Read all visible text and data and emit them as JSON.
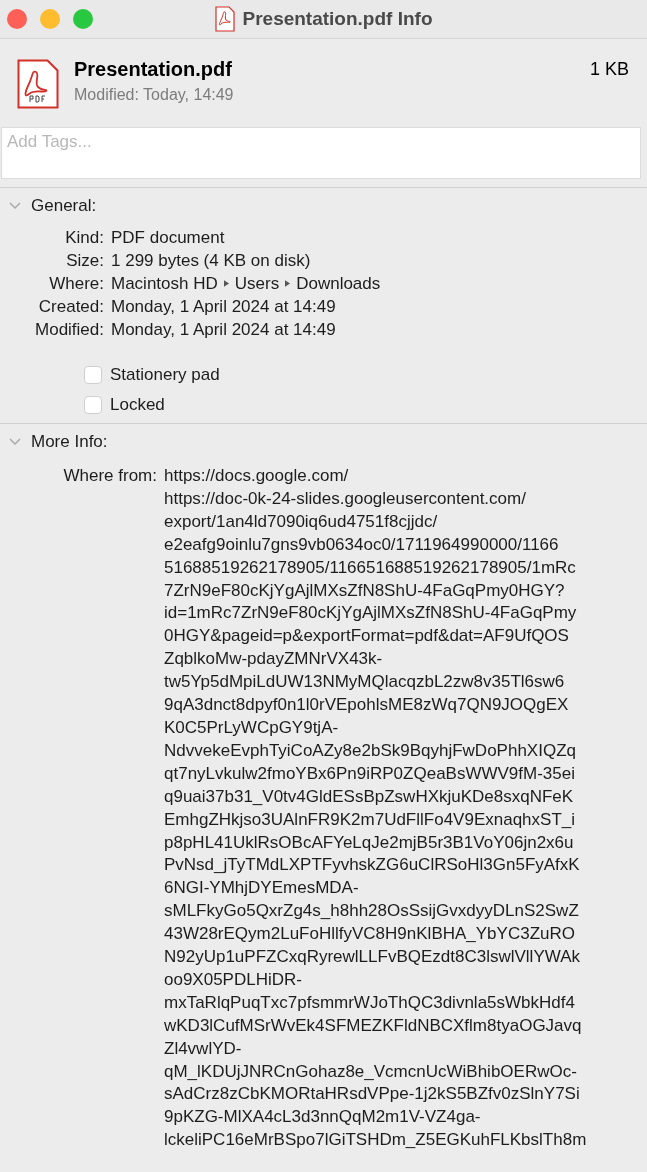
{
  "window": {
    "title": "Presentation.pdf Info"
  },
  "file": {
    "name": "Presentation.pdf",
    "size": "1 KB",
    "modified": "Modified: Today, 14:49"
  },
  "tags": {
    "placeholder": "Add Tags..."
  },
  "general": {
    "title": "General:",
    "expanded": true,
    "rows": [
      {
        "label": "Kind:",
        "value": "PDF document"
      },
      {
        "label": "Size:",
        "value": "1 299 bytes (4 KB on disk)"
      },
      {
        "label": "Where:",
        "path": [
          "Macintosh HD",
          "Users",
          "Downloads"
        ]
      },
      {
        "label": "Created:",
        "value": "Monday, 1 April 2024 at 14:49"
      },
      {
        "label": "Modified:",
        "value": "Monday, 1 April 2024 at 14:49"
      }
    ],
    "checkboxes": [
      {
        "label": "Stationery pad",
        "checked": false
      },
      {
        "label": "Locked",
        "checked": false
      }
    ]
  },
  "more_info": {
    "title": "More Info:",
    "expanded": true,
    "label": "Where from:",
    "lines": [
      "https://docs.google.com/",
      "https://doc-0k-24-slides.googleusercontent.com/",
      "export/1an4ld7090iq6ud4751f8cjjdc/",
      "e2eafg9oinlu7gns9vb0634oc0/1711964990000/1166",
      "51688519262178905/116651688519262178905/1mRc",
      "7ZrN9eF80cKjYgAjlMXsZfN8ShU-4FaGqPmy0HGY?",
      "id=1mRc7ZrN9eF80cKjYgAjlMXsZfN8ShU-4FaGqPmy",
      "0HGY&pageid=p&exportFormat=pdf&dat=AF9UfQOS",
      "ZqblkoMw-pdayZMNrVX43k-",
      "tw5Yp5dMpiLdUW13NMyMQlacqzbL2zw8v35Tl6sw6",
      "9qA3dnct8dpyf0n1l0rVEpohlsME8zWq7QN9JOQgEX",
      "K0C5PrLyWCpGY9tjA-",
      "NdvvekeEvphTyiCoAZy8e2bSk9BqyhjFwDoPhhXIQZq",
      "qt7nyLvkulw2fmoYBx6Pn9iRP0ZQeaBsWWV9fM-35ei",
      "q9uai37b31_V0tv4GldESsBpZswHXkjuKDe8sxqNFeK",
      "EmhgZHkjso3UAlnFR9K2m7UdFllFo4V9ExnaqhxST_i",
      "p8pHL41UklRsOBcAFYeLqJe2mjB5r3B1VoY06jn2x6u",
      "PvNsd_jTyTMdLXPTFyvhskZG6uClRSoHl3Gn5FyAfxK",
      "6NGI-YMhjDYEmesMDA-",
      "sMLFkyGo5QxrZg4s_h8hh28OsSsijGvxdyyDLnS2SwZ",
      "43W28rEQym2LuFoHllfyVC8H9nKlBHA_YbYC3ZuRO",
      "N92yUp1uPFZCxqRyrewlLLFvBQEzdt8C3lswlVllYWAk",
      "oo9X05PDLHiDR-",
      "mxTaRlqPuqTxc7pfsmmrWJoThQC3divnla5sWbkHdf4",
      "wKD3lCufMSrWvEk4SFMEZKFldNBCXflm8tyaOGJavq",
      "Zl4vwlYD-",
      "qM_lKDUjJNRCnGohaz8e_VcmcnUcWiBhibOERwOc-",
      "sAdCrz8zCbKMORtaHRsdVPpe-1j2kS5BZfv0zSlnY7Si",
      "9pKZG-MlXA4cL3d3nnQqM2m1V-VZ4ga-",
      "lckeliPC16eMrBSpo7lGiTSHDm_Z5EGKuhFLKbslTh8m"
    ]
  }
}
